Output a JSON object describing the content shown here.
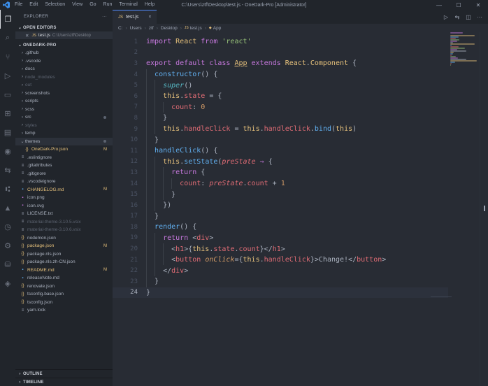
{
  "titlebar": {
    "menu": [
      "File",
      "Edit",
      "Selection",
      "View",
      "Go",
      "Run",
      "Terminal",
      "Help"
    ],
    "title": "C:\\Users\\ztf\\Desktop\\test.js - OneDark-Pro [Administrator]"
  },
  "activity_icons": [
    "files-icon",
    "search-icon",
    "source-control-icon",
    "run-debug-icon",
    "remote-explorer-icon",
    "extensions-icon",
    "docker-icon",
    "edge-devtools-icon",
    "live-share-icon",
    "git-graph-icon",
    "azure-icon",
    "timeline-icon",
    "settings-sync-icon",
    "database-icon",
    "layers-icon"
  ],
  "sidebar": {
    "title": "EXPLORER",
    "more": "···",
    "open_editors_label": "OPEN EDITORS",
    "open_editor": {
      "name": "test.js",
      "path": "C:\\Users\\ztf\\Desktop"
    },
    "project_label": "ONEDARK-PRO",
    "items": [
      {
        "name": ".github",
        "type": "folder",
        "style": ""
      },
      {
        "name": ".vscode",
        "type": "folder",
        "style": ""
      },
      {
        "name": "docs",
        "type": "folder",
        "style": ""
      },
      {
        "name": "node_modules",
        "type": "folder",
        "style": "dim"
      },
      {
        "name": "out",
        "type": "folder",
        "style": "dim"
      },
      {
        "name": "screenshots",
        "type": "folder",
        "style": ""
      },
      {
        "name": "scripts",
        "type": "folder",
        "style": ""
      },
      {
        "name": "scss",
        "type": "folder",
        "style": ""
      },
      {
        "name": "src",
        "type": "folder",
        "style": "",
        "dot": true
      },
      {
        "name": "styles",
        "type": "folder",
        "style": "dim"
      },
      {
        "name": "temp",
        "type": "folder",
        "style": ""
      },
      {
        "name": "themes",
        "type": "folder-open",
        "style": "sel",
        "dot": true
      },
      {
        "name": "OneDark-Pro.json",
        "type": "json",
        "style": "mod",
        "badge": "M",
        "indent": true
      },
      {
        "name": ".eslintignore",
        "type": "file",
        "style": ""
      },
      {
        "name": ".gitattributes",
        "type": "file",
        "style": ""
      },
      {
        "name": ".gitignore",
        "type": "file",
        "style": ""
      },
      {
        "name": ".vscodeignore",
        "type": "file",
        "style": ""
      },
      {
        "name": "CHANGELOG.md",
        "type": "md",
        "style": "mod",
        "badge": "M"
      },
      {
        "name": "icon.png",
        "type": "img",
        "style": ""
      },
      {
        "name": "icon.svg",
        "type": "img",
        "style": ""
      },
      {
        "name": "LICENSE.txt",
        "type": "file",
        "style": ""
      },
      {
        "name": "material-theme-3.10.5.vsix",
        "type": "file",
        "style": "dim"
      },
      {
        "name": "material-theme-3.10.6.vsix",
        "type": "file",
        "style": "dim"
      },
      {
        "name": "nodemon.json",
        "type": "json",
        "style": ""
      },
      {
        "name": "package.json",
        "type": "json",
        "style": "mod",
        "badge": "M"
      },
      {
        "name": "package.nls.json",
        "type": "json",
        "style": ""
      },
      {
        "name": "package.nls.zh-CN.json",
        "type": "json",
        "style": ""
      },
      {
        "name": "README.md",
        "type": "md",
        "style": "mod",
        "badge": "M"
      },
      {
        "name": "releaseNote.md",
        "type": "md",
        "style": ""
      },
      {
        "name": "renovate.json",
        "type": "json",
        "style": ""
      },
      {
        "name": "tsconfig.base.json",
        "type": "json",
        "style": ""
      },
      {
        "name": "tsconfig.json",
        "type": "json",
        "style": ""
      },
      {
        "name": "yarn.lock",
        "type": "file",
        "style": ""
      }
    ],
    "outline_label": "OUTLINE",
    "timeline_label": "TIMELINE"
  },
  "editor": {
    "tab": {
      "name": "test.js",
      "icon": "JS",
      "close": "×"
    },
    "breadcrumb": [
      "C:",
      "Users",
      "ztf",
      "Desktop",
      "test.js",
      "App"
    ],
    "current_line": 24,
    "code": [
      [
        [
          "k",
          "import "
        ],
        [
          "c",
          "React "
        ],
        [
          "k",
          "from "
        ],
        [
          "s",
          "'react'"
        ]
      ],
      [],
      [
        [
          "k",
          "export default class "
        ],
        [
          "c u",
          "App"
        ],
        [
          "k",
          " extends "
        ],
        [
          "c",
          "React"
        ],
        [
          "p",
          "."
        ],
        [
          "c",
          "Component "
        ],
        [
          "p",
          "{"
        ]
      ],
      [
        [
          "p",
          "  "
        ],
        [
          "f",
          "constructor"
        ],
        [
          "p",
          "() {"
        ]
      ],
      [
        [
          "p",
          "    "
        ],
        [
          "sp",
          "super"
        ],
        [
          "p",
          "()"
        ]
      ],
      [
        [
          "p",
          "    "
        ],
        [
          "y",
          "this"
        ],
        [
          "p",
          "."
        ],
        [
          "r",
          "state"
        ],
        [
          "p",
          " = {"
        ]
      ],
      [
        [
          "p",
          "      "
        ],
        [
          "r",
          "count"
        ],
        [
          "p",
          ": "
        ],
        [
          "n",
          "0"
        ]
      ],
      [
        [
          "p",
          "    }"
        ]
      ],
      [
        [
          "p",
          "    "
        ],
        [
          "y",
          "this"
        ],
        [
          "p",
          "."
        ],
        [
          "r",
          "handleClick"
        ],
        [
          "p",
          " = "
        ],
        [
          "y",
          "this"
        ],
        [
          "p",
          "."
        ],
        [
          "r",
          "handleClick"
        ],
        [
          "p",
          "."
        ],
        [
          "f",
          "bind"
        ],
        [
          "p",
          "("
        ],
        [
          "y",
          "this"
        ],
        [
          "p",
          ")"
        ]
      ],
      [
        [
          "p",
          "  }"
        ]
      ],
      [
        [
          "p",
          "  "
        ],
        [
          "f",
          "handleClick"
        ],
        [
          "p",
          "() {"
        ]
      ],
      [
        [
          "p",
          "    "
        ],
        [
          "y",
          "this"
        ],
        [
          "p",
          "."
        ],
        [
          "f",
          "setState"
        ],
        [
          "p",
          "("
        ],
        [
          "i",
          "preState"
        ],
        [
          "p",
          " "
        ],
        [
          "o",
          "⇒"
        ],
        [
          "p",
          " {"
        ]
      ],
      [
        [
          "p",
          "      "
        ],
        [
          "k",
          "return"
        ],
        [
          "p",
          " {"
        ]
      ],
      [
        [
          "p",
          "        "
        ],
        [
          "r",
          "count"
        ],
        [
          "p",
          ": "
        ],
        [
          "i",
          "preState"
        ],
        [
          "p",
          "."
        ],
        [
          "r",
          "count"
        ],
        [
          "p",
          " + "
        ],
        [
          "n",
          "1"
        ]
      ],
      [
        [
          "p",
          "      }"
        ]
      ],
      [
        [
          "p",
          "    })"
        ]
      ],
      [
        [
          "p",
          "  }"
        ]
      ],
      [
        [
          "p",
          "  "
        ],
        [
          "f",
          "render"
        ],
        [
          "p",
          "() {"
        ]
      ],
      [
        [
          "p",
          "    "
        ],
        [
          "k",
          "return"
        ],
        [
          "p",
          " <"
        ],
        [
          "t",
          "div"
        ],
        [
          "p",
          ">"
        ]
      ],
      [
        [
          "p",
          "      <"
        ],
        [
          "t",
          "h1"
        ],
        [
          "p",
          ">{"
        ],
        [
          "y",
          "this"
        ],
        [
          "p",
          "."
        ],
        [
          "r",
          "state"
        ],
        [
          "p",
          "."
        ],
        [
          "r",
          "count"
        ],
        [
          "p",
          "}</"
        ],
        [
          "t",
          "h1"
        ],
        [
          "p",
          ">"
        ]
      ],
      [
        [
          "p",
          "      <"
        ],
        [
          "t",
          "button "
        ],
        [
          "a",
          "onClick"
        ],
        [
          "p",
          "={"
        ],
        [
          "y",
          "this"
        ],
        [
          "p",
          "."
        ],
        [
          "r",
          "handleClick"
        ],
        [
          "p",
          "}>Change!</"
        ],
        [
          "t",
          "button"
        ],
        [
          "p",
          ">"
        ]
      ],
      [
        [
          "p",
          "    </"
        ],
        [
          "t",
          "div"
        ],
        [
          "p",
          ">"
        ]
      ],
      [
        [
          "p",
          "  }"
        ]
      ],
      [
        [
          "p",
          "}"
        ]
      ]
    ]
  },
  "colors": {
    "keyword": "#c678dd",
    "class": "#e5c07b",
    "string": "#98c379",
    "number": "#d19a66",
    "function": "#61afef",
    "property": "#e06c75",
    "background": "#282c34",
    "sidebar": "#21252b"
  }
}
